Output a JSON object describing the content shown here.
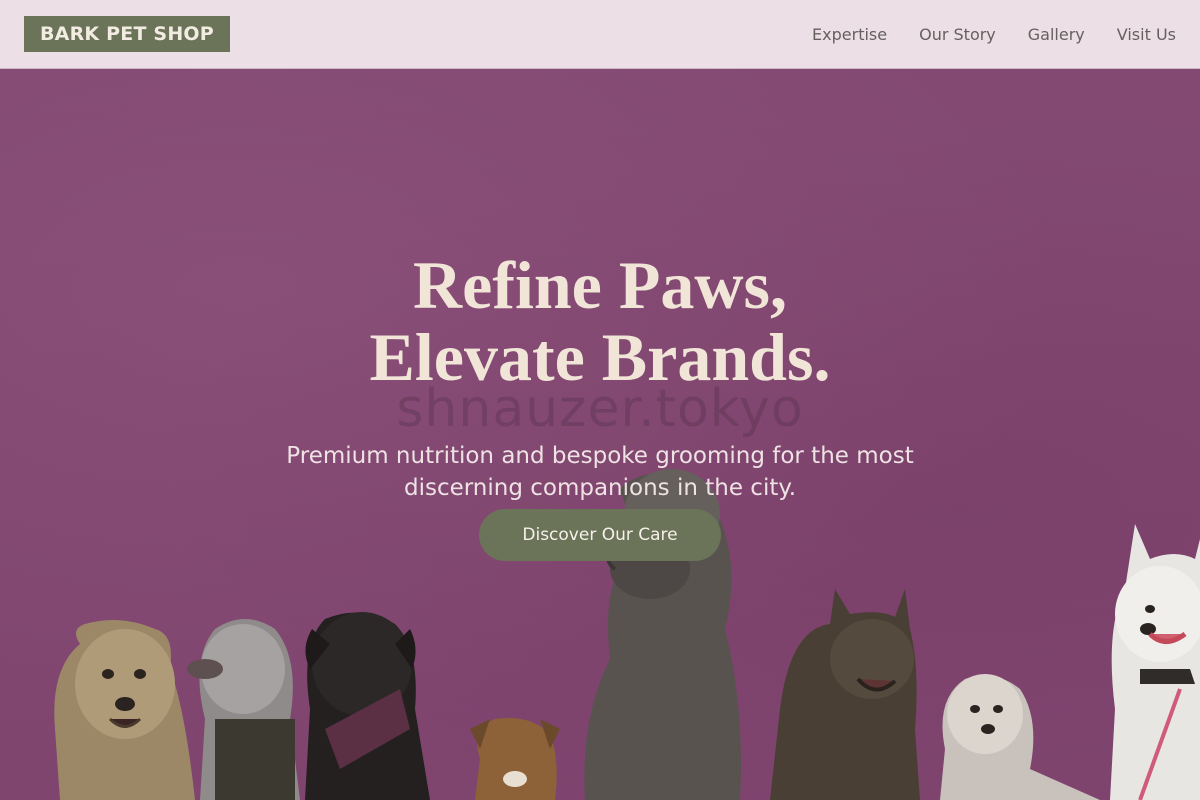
{
  "brand": {
    "logo_text": "BARK PET SHOP"
  },
  "nav": {
    "items": [
      {
        "label": "Expertise"
      },
      {
        "label": "Our Story"
      },
      {
        "label": "Gallery"
      },
      {
        "label": "Visit Us"
      }
    ]
  },
  "hero": {
    "headline_line1": "Refine Paws,",
    "headline_line2": "Elevate Brands.",
    "watermark": "shnauzer.tokyo",
    "subtitle": "Premium nutrition and bespoke grooming for the most discerning companions in the city.",
    "cta_label": "Discover Our Care"
  },
  "colors": {
    "nav_bg": "#ecdfe6",
    "accent": "#6b7359",
    "wall": "#8a4f78",
    "headline": "#f1e5d8"
  }
}
